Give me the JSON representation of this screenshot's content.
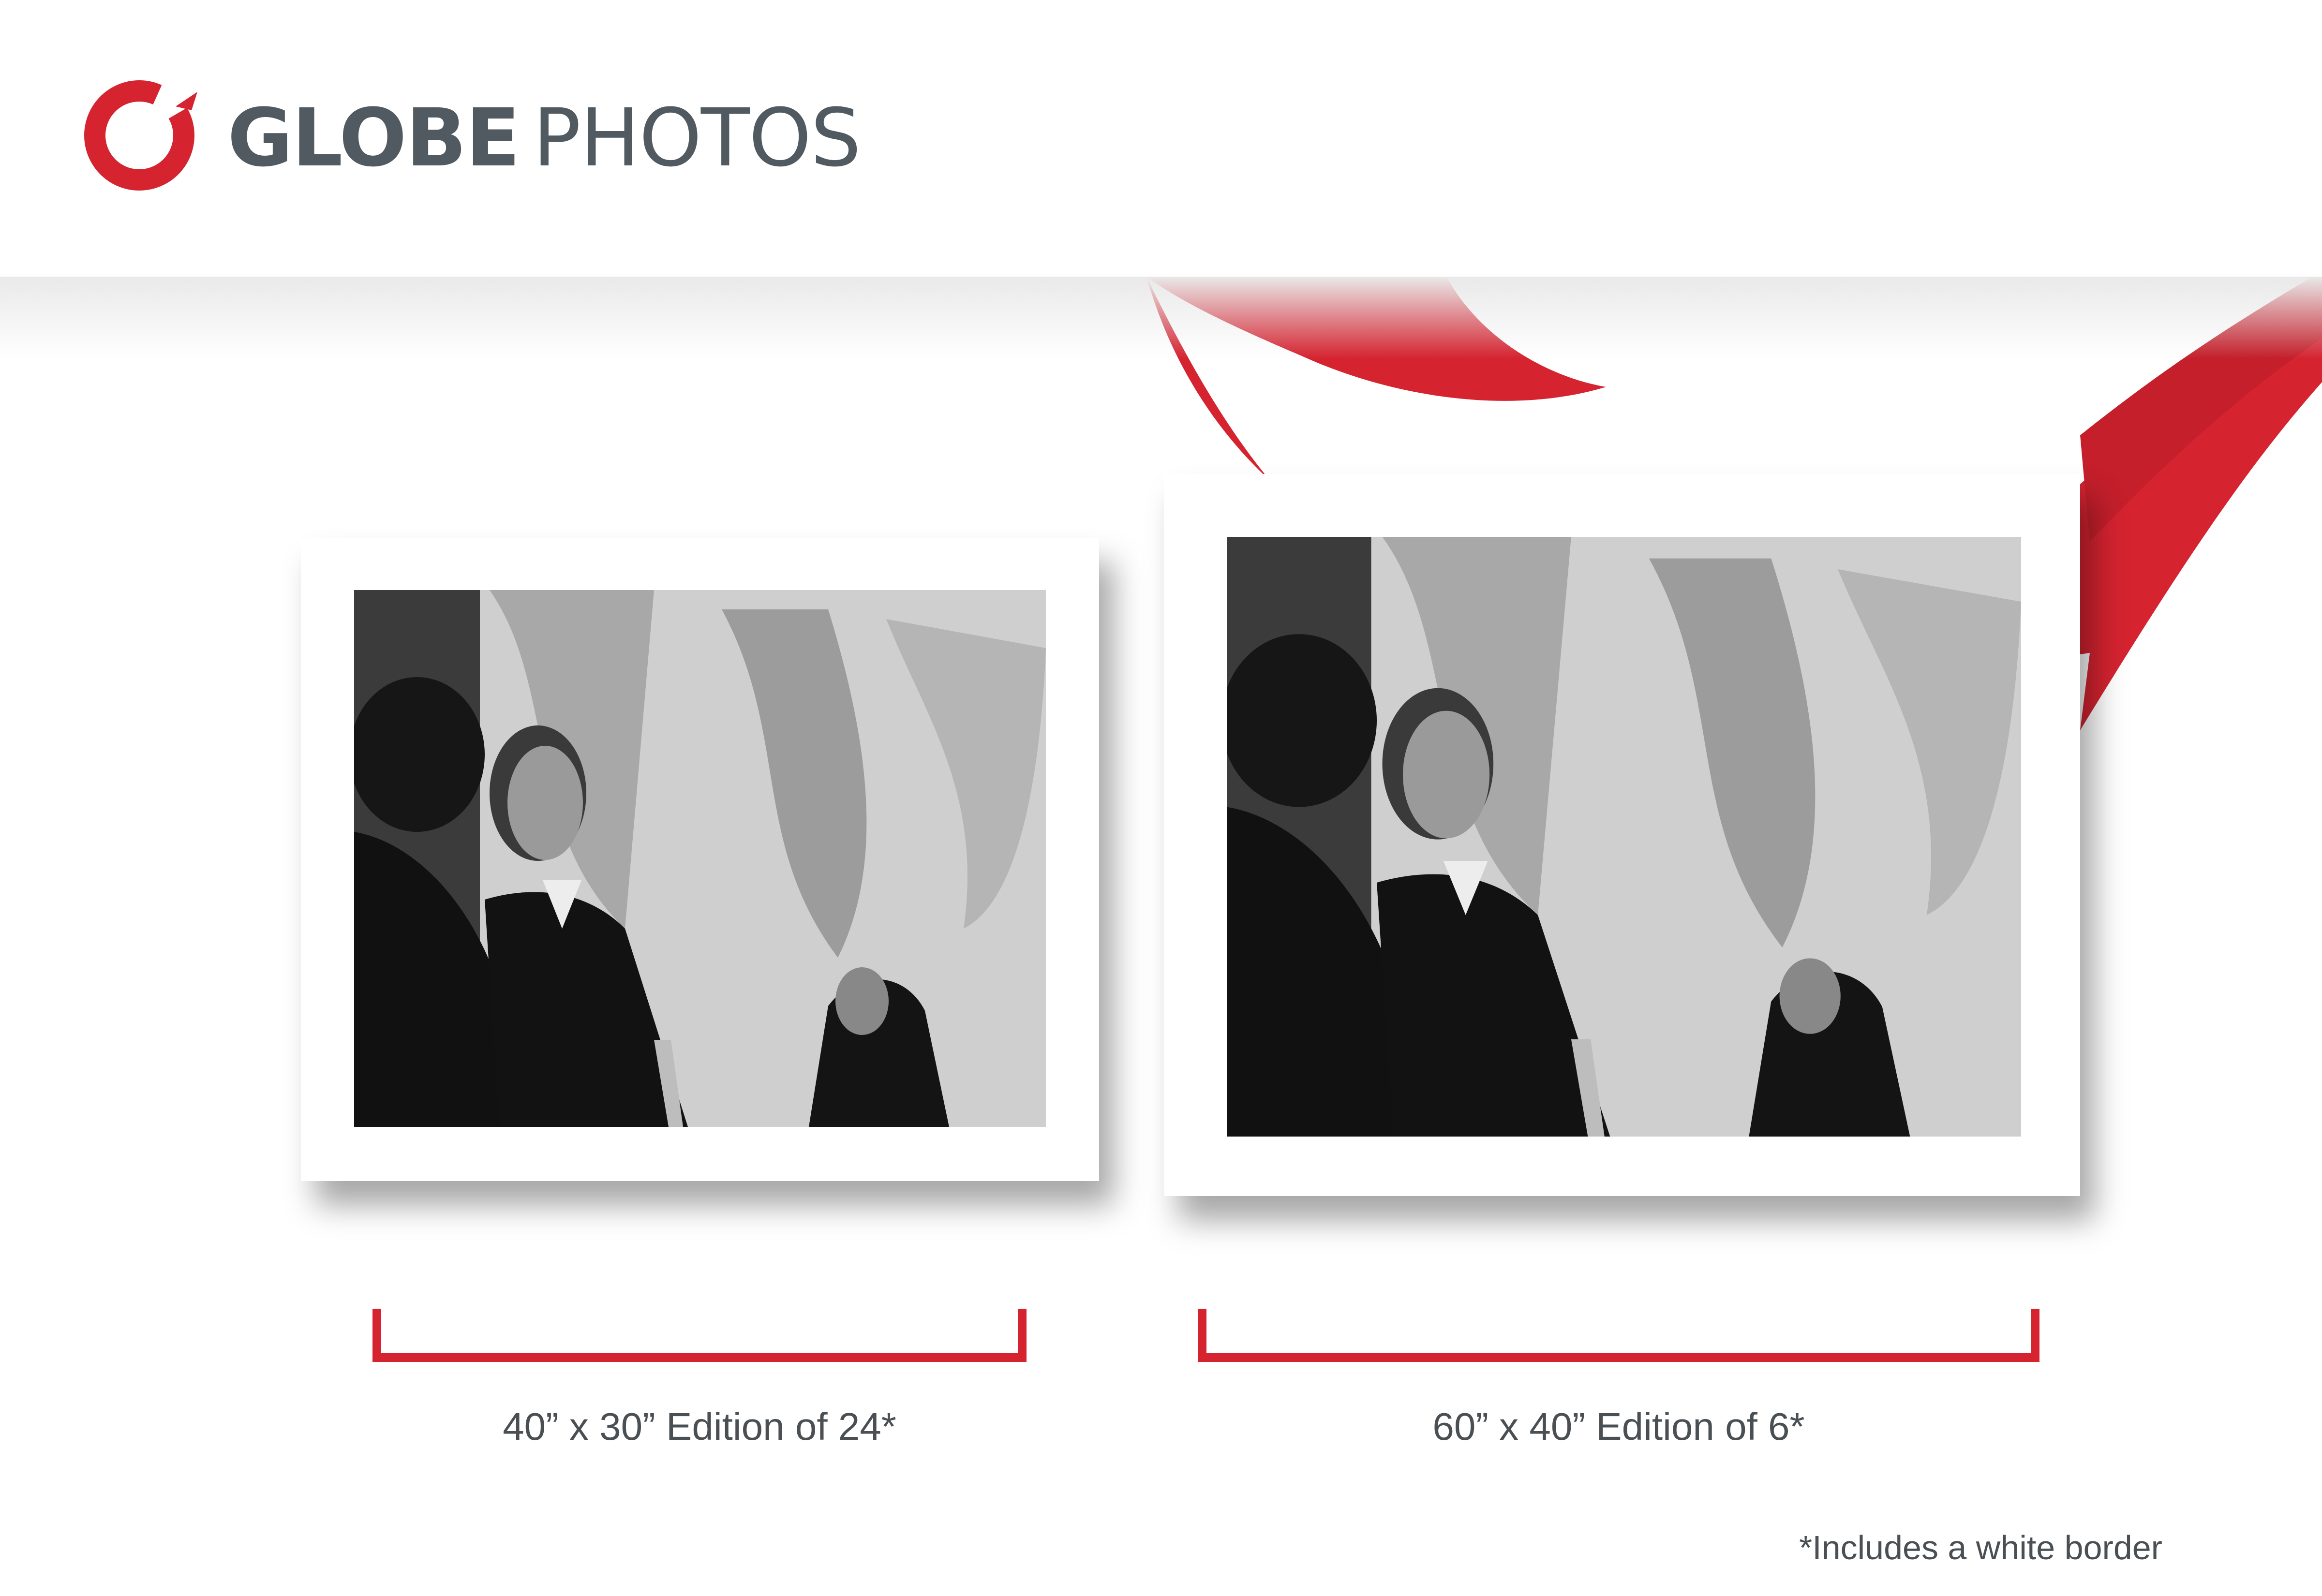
{
  "brand": {
    "name_bold": "GLOBE",
    "name_light": "PHOTOS",
    "logo_icon": "red-brush-circle-icon",
    "accent_color": "#d52330",
    "text_color": "#505a60"
  },
  "prints": [
    {
      "caption": "40” x 30” Edition of 24*",
      "image": "black-and-white photo of a man with an upturned mustache in front of a mural"
    },
    {
      "caption": "60” x 40” Edition of 6*",
      "image": "black-and-white photo of a man with an upturned mustache in front of a mural"
    }
  ],
  "footnote": "*Includes a white border"
}
